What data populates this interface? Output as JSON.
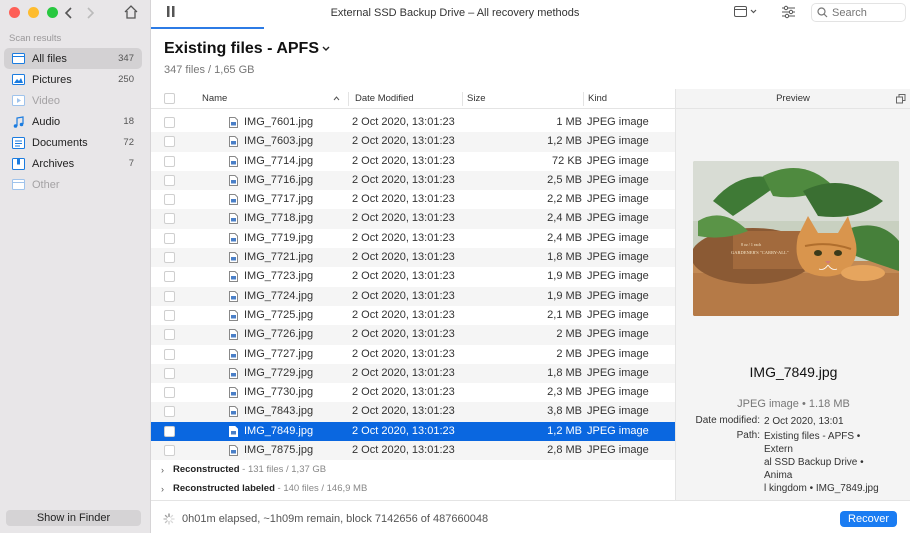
{
  "window": {
    "title": "External SSD Backup Drive – All recovery methods"
  },
  "search": {
    "placeholder": "Search"
  },
  "sidebar": {
    "heading": "Scan results",
    "items": [
      {
        "label": "All files",
        "count": "347",
        "icon": "all-files-icon",
        "active": true,
        "dim": false
      },
      {
        "label": "Pictures",
        "count": "250",
        "icon": "pictures-icon",
        "active": false,
        "dim": false
      },
      {
        "label": "Video",
        "count": "",
        "icon": "video-icon",
        "active": false,
        "dim": true
      },
      {
        "label": "Audio",
        "count": "18",
        "icon": "audio-icon",
        "active": false,
        "dim": false
      },
      {
        "label": "Documents",
        "count": "72",
        "icon": "documents-icon",
        "active": false,
        "dim": false
      },
      {
        "label": "Archives",
        "count": "7",
        "icon": "archives-icon",
        "active": false,
        "dim": false
      },
      {
        "label": "Other",
        "count": "",
        "icon": "other-icon",
        "active": false,
        "dim": true
      }
    ],
    "show_in_finder": "Show in Finder"
  },
  "content": {
    "title": "Existing files - APFS",
    "subtitle": "347 files / 1,65 GB"
  },
  "table": {
    "columns": {
      "name": "Name",
      "date": "Date Modified",
      "size": "Size",
      "kind": "Kind"
    },
    "rows": [
      {
        "name": "IMG_7601.jpg",
        "date": "2 Oct 2020, 13:01:23",
        "size": "1 MB",
        "kind": "JPEG image"
      },
      {
        "name": "IMG_7603.jpg",
        "date": "2 Oct 2020, 13:01:23",
        "size": "1,2 MB",
        "kind": "JPEG image"
      },
      {
        "name": "IMG_7714.jpg",
        "date": "2 Oct 2020, 13:01:23",
        "size": "72 KB",
        "kind": "JPEG image"
      },
      {
        "name": "IMG_7716.jpg",
        "date": "2 Oct 2020, 13:01:23",
        "size": "2,5 MB",
        "kind": "JPEG image"
      },
      {
        "name": "IMG_7717.jpg",
        "date": "2 Oct 2020, 13:01:23",
        "size": "2,2 MB",
        "kind": "JPEG image"
      },
      {
        "name": "IMG_7718.jpg",
        "date": "2 Oct 2020, 13:01:23",
        "size": "2,4 MB",
        "kind": "JPEG image"
      },
      {
        "name": "IMG_7719.jpg",
        "date": "2 Oct 2020, 13:01:23",
        "size": "2,4 MB",
        "kind": "JPEG image"
      },
      {
        "name": "IMG_7721.jpg",
        "date": "2 Oct 2020, 13:01:23",
        "size": "1,8 MB",
        "kind": "JPEG image"
      },
      {
        "name": "IMG_7723.jpg",
        "date": "2 Oct 2020, 13:01:23",
        "size": "1,9 MB",
        "kind": "JPEG image"
      },
      {
        "name": "IMG_7724.jpg",
        "date": "2 Oct 2020, 13:01:23",
        "size": "1,9 MB",
        "kind": "JPEG image"
      },
      {
        "name": "IMG_7725.jpg",
        "date": "2 Oct 2020, 13:01:23",
        "size": "2,1 MB",
        "kind": "JPEG image"
      },
      {
        "name": "IMG_7726.jpg",
        "date": "2 Oct 2020, 13:01:23",
        "size": "2 MB",
        "kind": "JPEG image"
      },
      {
        "name": "IMG_7727.jpg",
        "date": "2 Oct 2020, 13:01:23",
        "size": "2 MB",
        "kind": "JPEG image"
      },
      {
        "name": "IMG_7729.jpg",
        "date": "2 Oct 2020, 13:01:23",
        "size": "1,8 MB",
        "kind": "JPEG image"
      },
      {
        "name": "IMG_7730.jpg",
        "date": "2 Oct 2020, 13:01:23",
        "size": "2,3 MB",
        "kind": "JPEG image"
      },
      {
        "name": "IMG_7843.jpg",
        "date": "2 Oct 2020, 13:01:23",
        "size": "3,8 MB",
        "kind": "JPEG image"
      },
      {
        "name": "IMG_7849.jpg",
        "date": "2 Oct 2020, 13:01:23",
        "size": "1,2 MB",
        "kind": "JPEG image",
        "selected": true
      },
      {
        "name": "IMG_7875.jpg",
        "date": "2 Oct 2020, 13:01:23",
        "size": "2,8 MB",
        "kind": "JPEG image"
      }
    ],
    "groups": [
      {
        "name": "Reconstructed",
        "meta": "131 files / 1,37 GB"
      },
      {
        "name": "Reconstructed labeled",
        "meta": "140 files / 146,9 MB"
      }
    ]
  },
  "preview": {
    "heading": "Preview",
    "filename": "IMG_7849.jpg",
    "kind_line": "JPEG image • 1.18 MB",
    "date_key": "Date modified:",
    "date_val": "2 Oct 2020, 13:01",
    "path_key": "Path:",
    "path_lines": [
      "Existing files - APFS • Extern",
      "al SSD Backup Drive • Anima",
      "l kingdom • IMG_7849.jpg"
    ],
    "image_text_1": "8 oz / 1 each",
    "image_text_2": "GARDENER'S \"CARRY-ALL\""
  },
  "status": {
    "text": "0h01m elapsed, ~1h09m remain, block 7142656 of 487660048",
    "recover": "Recover"
  },
  "colors": {
    "accent": "#0a67e0",
    "recover": "#1a7cf2",
    "sidebar_bg": "#e8e6e8"
  }
}
